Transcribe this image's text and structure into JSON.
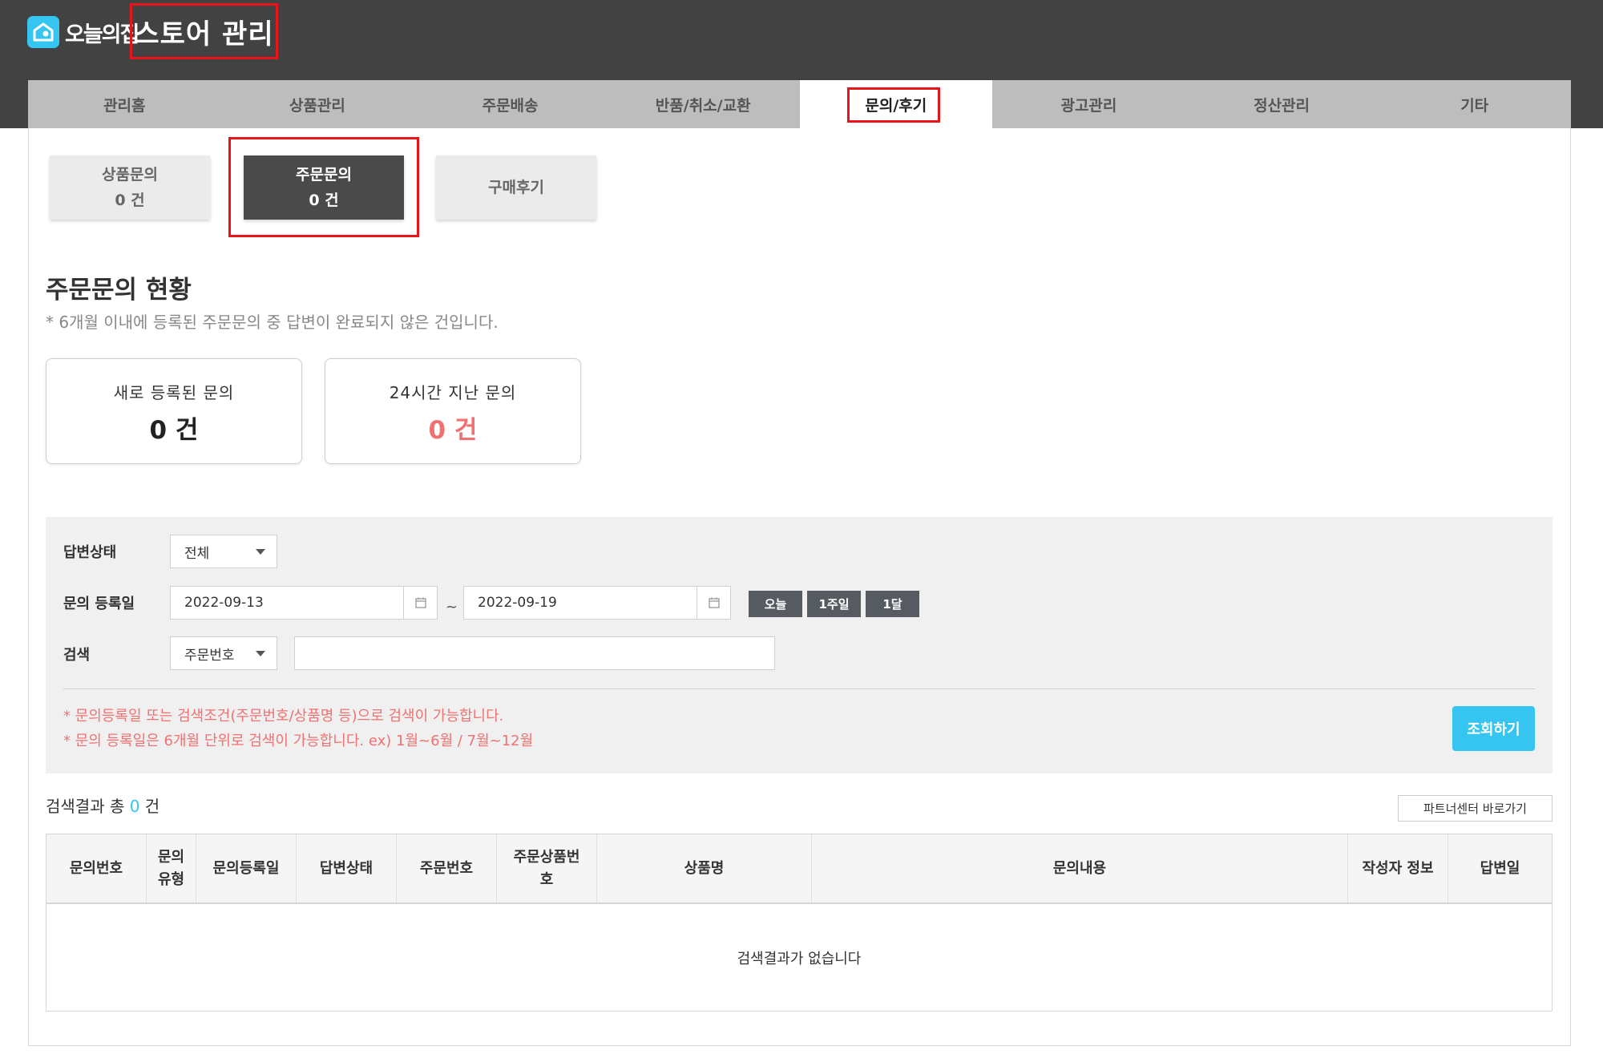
{
  "brand": {
    "logo_text": "오늘의집",
    "store_title": "스토어 관리",
    "accent": "#35c5f0",
    "highlight": "#e8141a"
  },
  "nav": {
    "items": [
      "관리홈",
      "상품관리",
      "주문배송",
      "반품/취소/교환",
      "문의/후기",
      "광고관리",
      "정산관리",
      "기타"
    ],
    "active": "문의/후기"
  },
  "subtabs": [
    {
      "name": "상품문의",
      "count": "0 건"
    },
    {
      "name": "주문문의",
      "count": "0 건",
      "active": true
    },
    {
      "name": "구매후기"
    }
  ],
  "status": {
    "title": "주문문의 현황",
    "note": "* 6개월 이내에 등록된 주문문의 중 답변이 완료되지 않은 건입니다.",
    "new_label": "새로 등록된 문의",
    "new_value": "0 건",
    "overdue_label": "24시간 지난 문의",
    "overdue_value": "0 건"
  },
  "filter": {
    "status_label": "답변상태",
    "status_value": "전체",
    "date_label": "문의 등록일",
    "date_from": "2022-09-13",
    "date_to": "2022-09-19",
    "date_sep": "~",
    "quick_buttons": [
      "오늘",
      "1주일",
      "1달"
    ],
    "search_label": "검색",
    "search_type": "주문번호",
    "search_value": "",
    "note1": "* 문의등록일 또는 검색조건(주문번호/상품명 등)으로 검색이 가능합니다.",
    "note2": "* 문의 등록일은 6개월 단위로 검색이 가능합니다. ex) 1월~6월 / 7월~12월",
    "search_button": "조회하기"
  },
  "results": {
    "prefix": "검색결과 총 ",
    "count": "0",
    "suffix": " 건",
    "partner_button": "파트너센터 바로가기",
    "columns": [
      "문의번호",
      "문의\n유형",
      "문의등록일",
      "답변상태",
      "주문번호",
      "주문상품번\n호",
      "상품명",
      "문의내용",
      "작성자 정보",
      "답변일"
    ],
    "empty": "검색결과가 없습니다"
  }
}
